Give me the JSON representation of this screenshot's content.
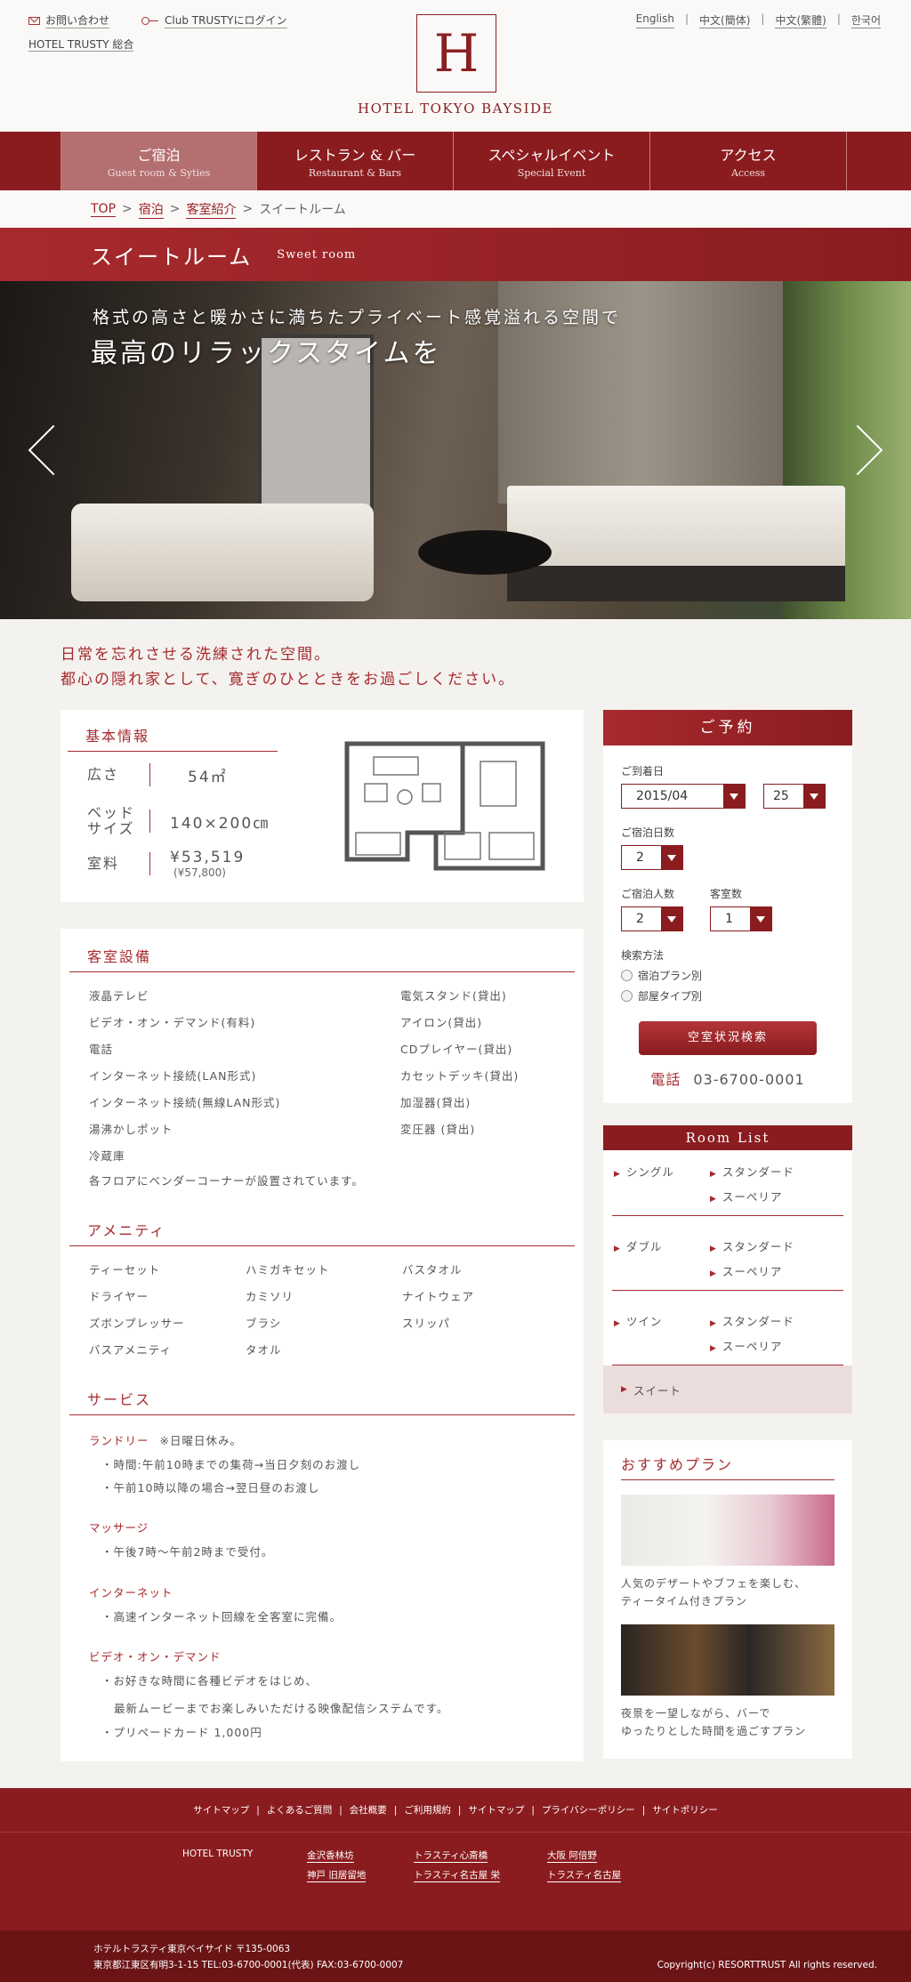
{
  "header": {
    "contact": "お問い合わせ",
    "club_login": "Club TRUSTYにログイン",
    "general": "HOTEL TRUSTY 総合",
    "logo_letter": "H",
    "logo_text": "HOTEL TOKYO BAYSIDE",
    "langs": [
      "English",
      "中文(簡体)",
      "中文(繁體)",
      "한국어"
    ]
  },
  "nav": [
    {
      "jp": "ご宿泊",
      "en": "Guest room & Syties"
    },
    {
      "jp": "レストラン & バー",
      "en": "Restaurant & Bars"
    },
    {
      "jp": "スペシャルイベント",
      "en": "Special Event"
    },
    {
      "jp": "アクセス",
      "en": "Access"
    }
  ],
  "breadcrumb": {
    "top": "TOP",
    "stay": "宿泊",
    "rooms": "客室紹介",
    "current": "スイートルーム",
    "sep": ">"
  },
  "title": {
    "jp": "スイートルーム",
    "en": "Sweet room"
  },
  "hero": {
    "caption1": "格式の高さと暖かさに満ちたプライベート感覚溢れる空間で",
    "caption2": "最高のリラックスタイムを"
  },
  "lead": {
    "line1": "日常を忘れさせる洗練された空間。",
    "line2": "都心の隠れ家として、寛ぎのひとときをお過ごしください。"
  },
  "basic": {
    "heading": "基本情報",
    "size_label": "広さ",
    "size_value": "54㎡",
    "bed_label": "ベッドサイズ",
    "bed_value": "140×200㎝",
    "price_label": "室料",
    "price_value": "¥53,519",
    "price_tax": "(¥57,800)"
  },
  "equipment": {
    "heading": "客室設備",
    "items": [
      "液晶テレビ",
      "電気スタンド(貸出)",
      "ビデオ・オン・デマンド(有料)",
      "アイロン(貸出)",
      "電話",
      "CDプレイヤー(貸出)",
      "インターネット接続(LAN形式)",
      "カセットデッキ(貸出)",
      "インターネット接続(無線LAN形式)",
      "加湿器(貸出)",
      "湯沸かしポット",
      "変圧器 (貸出)",
      "冷蔵庫",
      ""
    ],
    "note": "各フロアにベンダーコーナーが設置されています。"
  },
  "amenity": {
    "heading": "アメニティ",
    "items": [
      "ティーセット",
      "ハミガキセット",
      "バスタオル",
      "ドライヤー",
      "カミソリ",
      "ナイトウェア",
      "ズボンプレッサー",
      "ブラシ",
      "スリッパ",
      "バスアメニティ",
      "タオル",
      ""
    ]
  },
  "service": {
    "heading": "サービス",
    "laundry": "ランドリー",
    "laundry_note": "※日曜日休み。",
    "laundry1": "・時間:午前10時までの集荷→当日夕刻のお渡し",
    "laundry2": "・午前10時以降の場合→翌日昼のお渡し",
    "massage": "マッサージ",
    "massage1": "・午後7時〜午前2時まで受付。",
    "internet": "インターネット",
    "internet1": "・高速インターネット回線を全客室に完備。",
    "vod": "ビデオ・オン・デマンド",
    "vod1": "・お好きな時間に各種ビデオをはじめ、",
    "vod2": "最新ムービーまでお楽しみいただける映像配信システムです。",
    "vod3": "・プリペードカード 1,000円"
  },
  "reserve": {
    "heading": "ご予約",
    "arrival_label": "ご到着日",
    "month": "2015/04",
    "day": "25",
    "nights_label": "ご宿泊日数",
    "nights": "2",
    "guests_label": "ご宿泊人数",
    "guests": "2",
    "rooms_label": "客室数",
    "rooms": "1",
    "method_label": "検索方法",
    "opt1": "宿泊プラン別",
    "opt2": "部屋タイプ別",
    "search_btn": "空室状況検索",
    "tel_label": "電話",
    "tel": "03-6700-0001"
  },
  "roomlist": {
    "heading": "Room List",
    "single": "シングル",
    "double": "ダブル",
    "twin": "ツイン",
    "standard": "スタンダード",
    "superior": "スーペリア",
    "suite": "スイート"
  },
  "plans": {
    "heading": "おすすめプラン",
    "p1a": "人気のデザートやブフェを楽しむ、",
    "p1b": "ティータイム付きプラン",
    "p2a": "夜景を一望しながら、バーで",
    "p2b": "ゆったりとした時間を過ごすプラン"
  },
  "footer": {
    "links": [
      "サイトマップ",
      "よくあるご質問",
      "会社概要",
      "ご利用規約",
      "サイトマップ",
      "プライバシーポリシー",
      "サイトポリシー"
    ],
    "brand": "HOTEL TRUSTY",
    "h1": "金沢香林坊",
    "h2": "神戸 旧居留地",
    "h3": "トラスティ心斎橋",
    "h4": "トラスティ名古屋 栄",
    "h5": "大阪 阿倍野",
    "h6": "トラスティ名古屋",
    "addr1": "ホテルトラスティ東京ベイサイド 〒135-0063",
    "addr2": "東京都江東区有明3-1-15 TEL:03-6700-0001(代表) FAX:03-6700-0007",
    "copyright": "Copyright(c) RESORTTRUST All rights reserved."
  }
}
